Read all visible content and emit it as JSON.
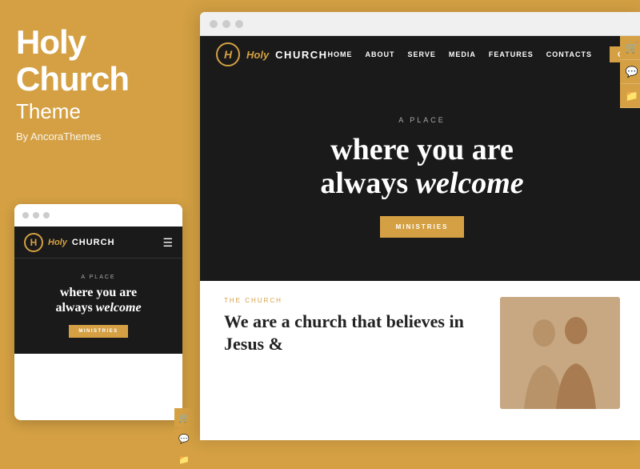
{
  "left": {
    "title_line1": "Holy",
    "title_line2": "Church",
    "subtitle": "Theme",
    "by": "By AncoraThemes"
  },
  "mobile": {
    "logo_italic": "Holy",
    "logo_bold": "CHURCH",
    "logo_letter": "H",
    "a_place": "A PLACE",
    "headline_line1": "where you are",
    "headline_line2": "always",
    "headline_italic": "welcome",
    "btn_label": "MINISTRIES"
  },
  "desktop": {
    "logo_italic": "Holy",
    "logo_bold": "CHURCH",
    "logo_letter": "H",
    "menu_items": [
      "HOME",
      "ABOUT",
      "SERVE",
      "MEDIA",
      "FEATURES",
      "CONTACTS"
    ],
    "give_label": "GIVE",
    "a_place": "A PLACE",
    "headline_line1": "where you are",
    "headline_line2": "always",
    "headline_italic": "welcome",
    "btn_label": "MINISTRIES",
    "section_label": "THE CHURCH",
    "bottom_headline": "We are a church that believes in Jesus &"
  },
  "colors": {
    "gold": "#d4a043",
    "dark": "#1a1a1a",
    "white": "#ffffff"
  }
}
